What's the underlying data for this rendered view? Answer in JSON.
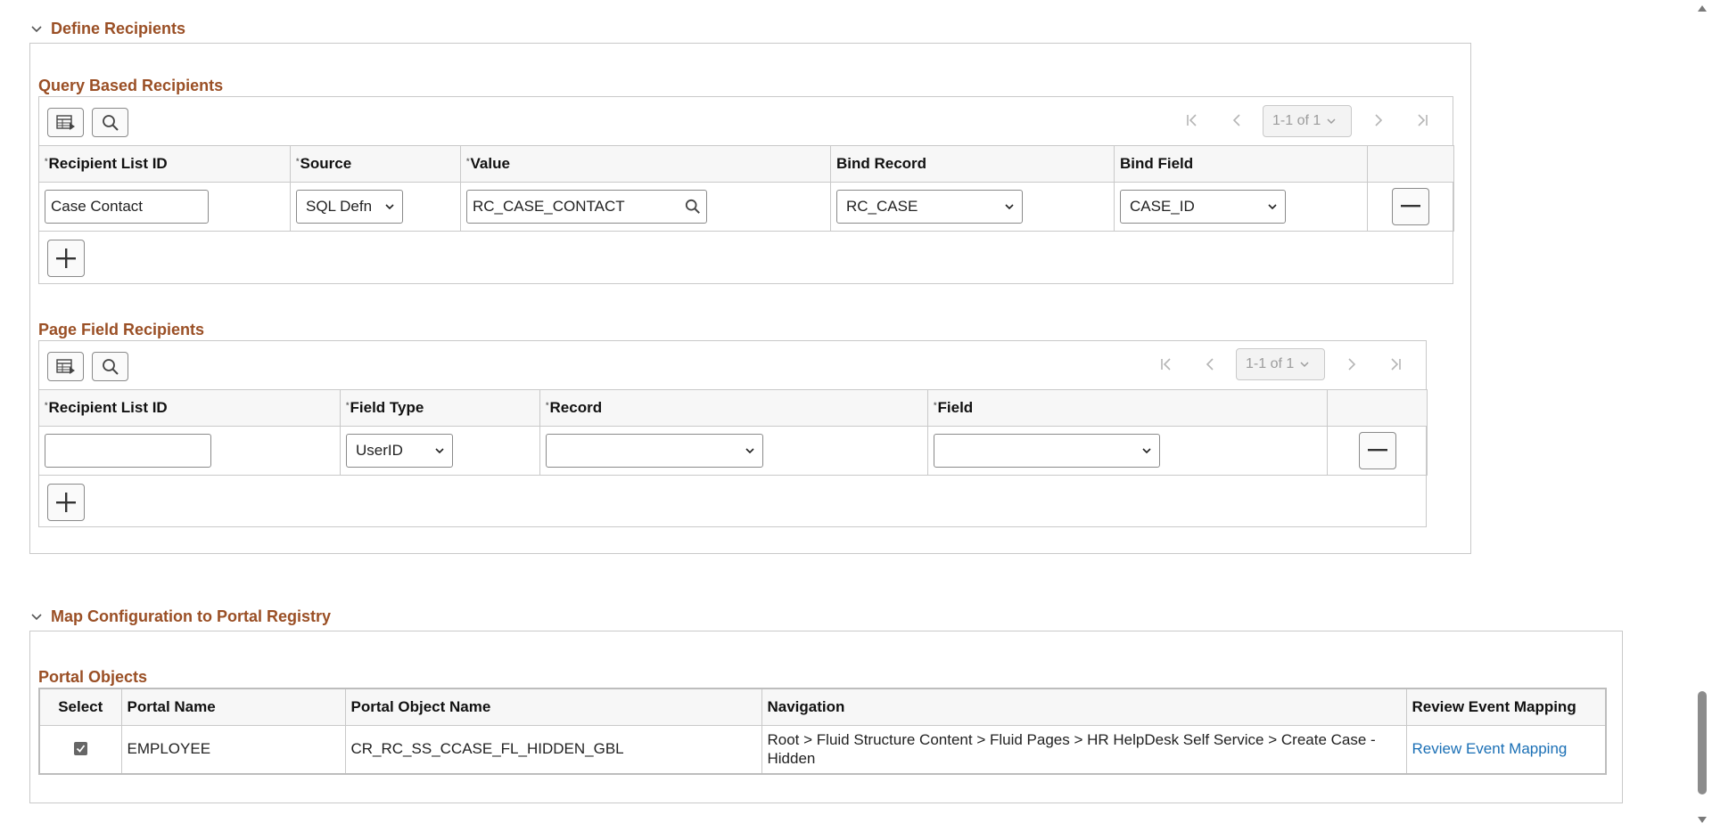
{
  "define_recipients": {
    "title": "Define Recipients",
    "query_based": {
      "title": "Query Based Recipients",
      "pager": "1-1 of 1",
      "columns": [
        "Recipient List ID",
        "Source",
        "Value",
        "Bind Record",
        "Bind Field"
      ],
      "row": {
        "recipient_list_id": "Case Contact",
        "source": "SQL Defn",
        "value": "RC_CASE_CONTACT",
        "bind_record": "RC_CASE",
        "bind_field": "CASE_ID"
      }
    },
    "page_field": {
      "title": "Page Field Recipients",
      "pager": "1-1 of 1",
      "columns": [
        "Recipient List ID",
        "Field Type",
        "Record",
        "Field"
      ],
      "row": {
        "recipient_list_id": "",
        "field_type": "UserID",
        "record": "",
        "field": ""
      }
    }
  },
  "portal_registry": {
    "title": "Map Configuration to Portal Registry",
    "portal_objects": {
      "title": "Portal Objects",
      "columns": [
        "Select",
        "Portal Name",
        "Portal Object Name",
        "Navigation",
        "Review Event Mapping"
      ],
      "row": {
        "selected": true,
        "portal_name": "EMPLOYEE",
        "portal_object_name": "CR_RC_SS_CCASE_FL_HIDDEN_GBL",
        "navigation": "Root > Fluid Structure Content > Fluid Pages > HR HelpDesk Self Service > Create Case - Hidden",
        "review_link": "Review Event Mapping"
      }
    }
  },
  "colors": {
    "section_title": "#9a4f25",
    "link": "#1a6fb5",
    "border": "#c9c9c9"
  }
}
